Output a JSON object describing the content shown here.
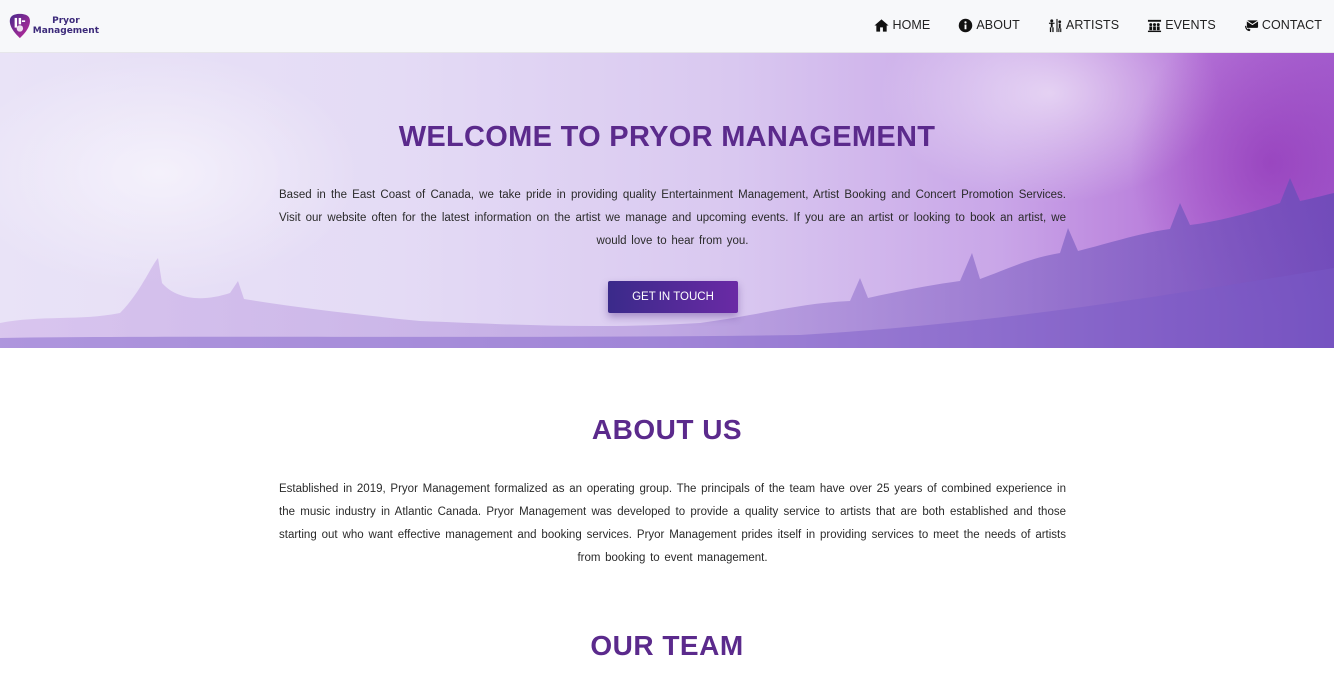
{
  "brand": {
    "line1": "Pryor",
    "line2": "Management",
    "icon": "guitar-pick-logo"
  },
  "nav": {
    "items": [
      {
        "label": "HOME",
        "icon": "home-icon"
      },
      {
        "label": "ABOUT",
        "icon": "info-icon"
      },
      {
        "label": "ARTISTS",
        "icon": "artists-icon"
      },
      {
        "label": "EVENTS",
        "icon": "events-icon"
      },
      {
        "label": "CONTACT",
        "icon": "contact-icon"
      }
    ]
  },
  "hero": {
    "title": "WELCOME TO PRYOR MANAGEMENT",
    "text": "Based in the East Coast of Canada, we take pride in providing quality Entertainment Management, Artist Booking and Concert Promotion Services. Visit our website often for the latest information on the artist we manage and upcoming events. If you are an artist or looking to book an artist, we would love to hear from you.",
    "cta_label": "GET IN TOUCH"
  },
  "about": {
    "title": "ABOUT US",
    "text": "Established in 2019, Pryor Management formalized as an operating group. The principals of the team have over 25 years of combined experience in the music industry in Atlantic Canada. Pryor Management was developed to provide a quality service to artists that are both established and those starting out who want effective management and booking services. Pryor Management prides itself in providing services to meet the needs of artists from booking to event management."
  },
  "team": {
    "title": "OUR TEAM"
  },
  "colors": {
    "accent": "#5b2a8c",
    "button_start": "#3a2a8a",
    "button_end": "#6a2aa5"
  }
}
